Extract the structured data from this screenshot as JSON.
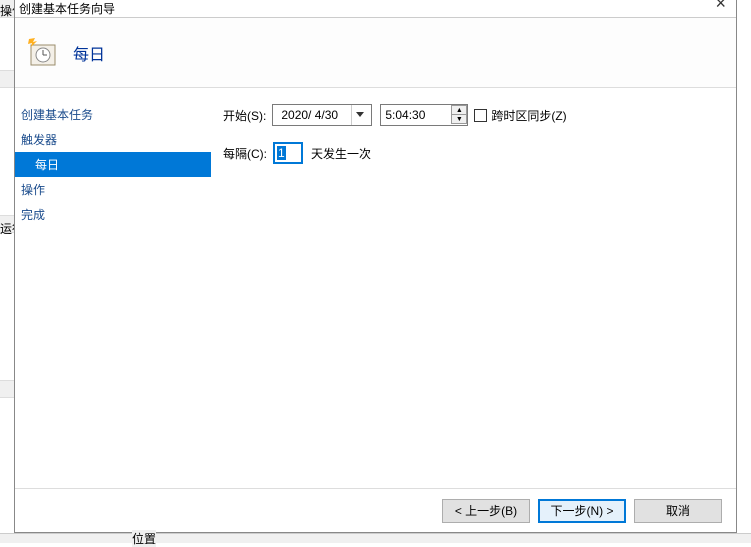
{
  "bg": {
    "op_label": "操作",
    "run_label": "运行",
    "pos_label": "位置"
  },
  "dialog": {
    "title": "创建基本任务向导",
    "header_title": "每日"
  },
  "sidebar": {
    "items": [
      {
        "label": "创建基本任务",
        "child": false
      },
      {
        "label": "触发器",
        "child": false
      },
      {
        "label": "每日",
        "child": true,
        "selected": true
      },
      {
        "label": "操作",
        "child": false
      },
      {
        "label": "完成",
        "child": false
      }
    ]
  },
  "form": {
    "start_label": "开始(S):",
    "date_value": "2020/ 4/30",
    "time_value": "5:04:30",
    "tz_sync_label": "跨时区同步(Z)",
    "interval_label": "每隔(C):",
    "interval_value": "1",
    "interval_suffix": "天发生一次"
  },
  "footer": {
    "back": "< 上一步(B)",
    "next": "下一步(N) >",
    "cancel": "取消"
  }
}
